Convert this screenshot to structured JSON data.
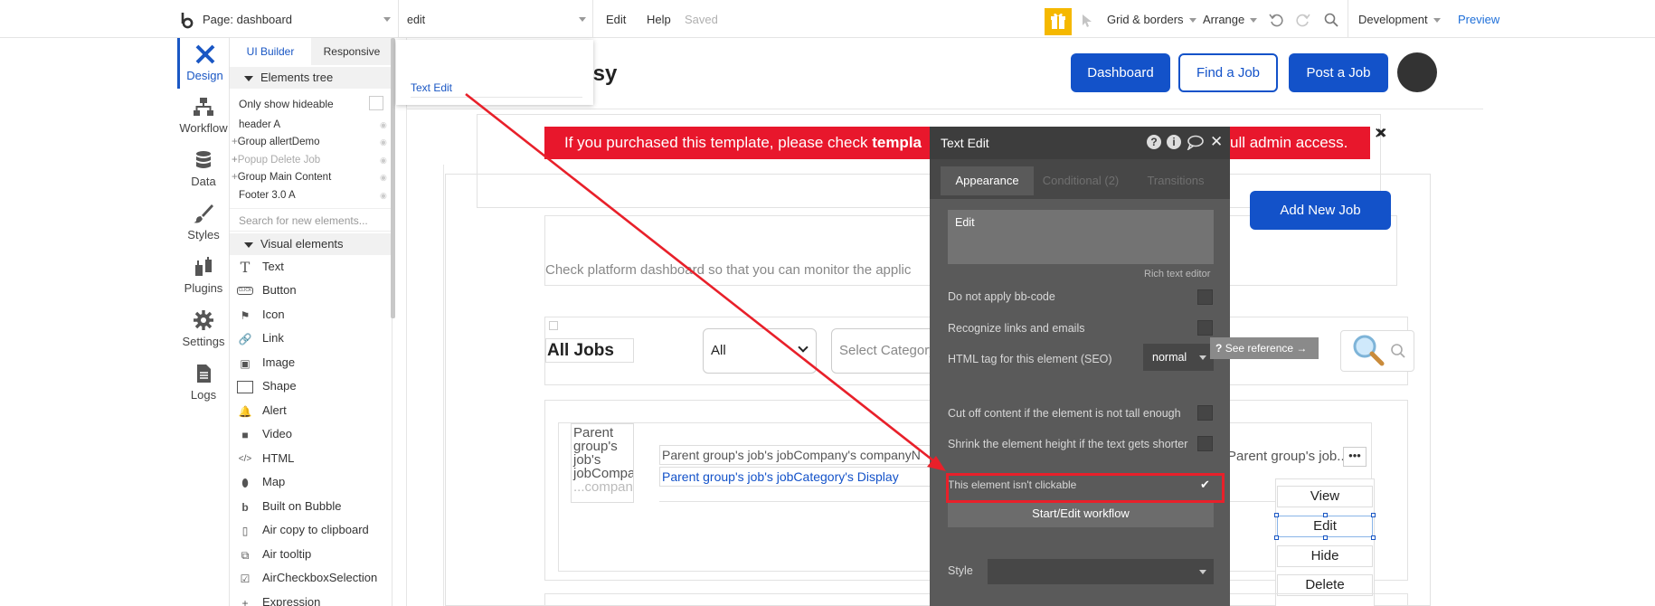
{
  "topbar": {
    "page_label": "Page: dashboard",
    "search_value": "edit",
    "menu_edit": "Edit",
    "menu_help": "Help",
    "status": "Saved",
    "grid_borders": "Grid & borders",
    "arrange": "Arrange",
    "environment": "Development",
    "preview": "Preview"
  },
  "rail": {
    "items": [
      {
        "label": "Design",
        "icon": "design-icon"
      },
      {
        "label": "Workflow",
        "icon": "workflow-icon"
      },
      {
        "label": "Data",
        "icon": "database-icon"
      },
      {
        "label": "Styles",
        "icon": "brush-icon"
      },
      {
        "label": "Plugins",
        "icon": "plug-icon"
      },
      {
        "label": "Settings",
        "icon": "gear-icon"
      },
      {
        "label": "Logs",
        "icon": "document-icon"
      }
    ]
  },
  "panel": {
    "tab_ui_builder": "UI Builder",
    "tab_responsive": "Responsive",
    "elements_tree": "Elements tree",
    "only_hideable": "Only show hideable",
    "tree": [
      "header A",
      "Group allertDemo",
      "Popup Delete Job",
      "Group Main Content",
      "Footer 3.0 A"
    ],
    "search_placeholder": "Search for new elements...",
    "visual_elements": "Visual elements",
    "visual": [
      "Text",
      "Button",
      "Icon",
      "Link",
      "Image",
      "Shape",
      "Alert",
      "Video",
      "HTML",
      "Map",
      "Built on Bubble",
      "Air copy to clipboard",
      "Air tooltip",
      "AirCheckboxSelection",
      "Expression"
    ]
  },
  "dropdown": {
    "result": "Text Edit"
  },
  "canvas": {
    "logo_fragment": "osy",
    "nav_dashboard": "Dashboard",
    "nav_find_job": "Find a Job",
    "nav_post_job": "Post a Job",
    "alert_prefix": "If you purchased this template, please check ",
    "alert_bold": "templa",
    "alert_suffix": "ull admin access.",
    "alert_close": "✕",
    "add_new_job": "Add New Job",
    "subtitle": "Check platform dashboard so that you can monitor the applic",
    "all_jobs": "All Jobs",
    "filter_all": "All",
    "select_category": "Select Category",
    "parent_group_text": "Parent group's job's jobCompany's companyN",
    "parent_group_category": "Parent group's job's jobCategory's Display",
    "parent_group_short": "Parent group's job...",
    "image_placeholder": "Parent group's job's jobCompa",
    "image_placeholder_tail": "...company",
    "menu_view": "View",
    "menu_edit": "Edit",
    "menu_hide": "Hide",
    "menu_delete": "Delete"
  },
  "editor": {
    "title": "Text Edit",
    "tab_appearance": "Appearance",
    "tab_conditional": "Conditional (2)",
    "tab_transitions": "Transitions",
    "text_value": "Edit",
    "rich_text": "Rich text editor",
    "no_bbcode": "Do not apply bb-code",
    "recognize_links": "Recognize links and emails",
    "html_tag": "HTML tag for this element (SEO)",
    "html_tag_value": "normal",
    "see_reference": "See reference →",
    "cut_off": "Cut off content if the element is not tall enough",
    "shrink": "Shrink the element height if the text gets shorter",
    "not_clickable": "This element isn't clickable",
    "workflow_btn": "Start/Edit workflow",
    "style_label": "Style"
  },
  "colors": {
    "brand_blue": "#1352c9",
    "alert_red": "#e8172c",
    "annotation_red": "#e8202a",
    "editor_bg": "#5a5a5a",
    "editor_head": "#3d3d3d",
    "gift_yellow": "#f5b800"
  }
}
